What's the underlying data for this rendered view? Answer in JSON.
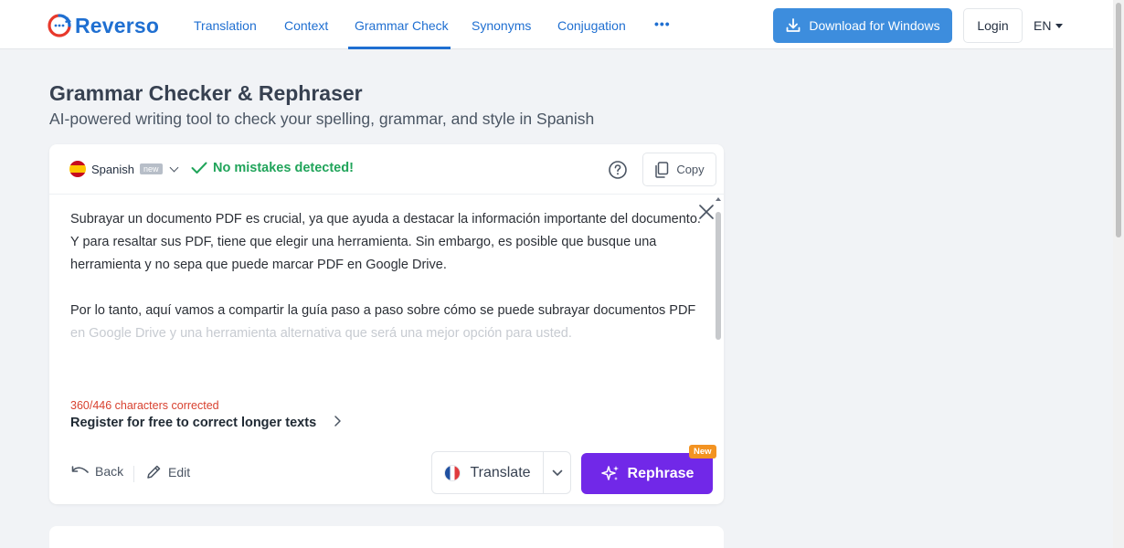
{
  "header": {
    "logo_text": "Reverso",
    "nav": [
      "Translation",
      "Context",
      "Grammar Check",
      "Synonyms",
      "Conjugation"
    ],
    "more_label": "•••",
    "download_label": "Download for Windows",
    "login_label": "Login",
    "lang_label": "EN"
  },
  "page": {
    "title": "Grammar Checker & Rephraser",
    "subtitle": "AI-powered writing tool to check your spelling, grammar, and style in Spanish"
  },
  "editor": {
    "language": "Spanish",
    "language_badge": "new",
    "status": "No mistakes detected!",
    "copy_label": "Copy",
    "paragraph1": "Subrayar un documento PDF es crucial, ya que ayuda a destacar la información importante del documento. Y para resaltar sus PDF, tiene que elegir una herramienta. Sin embargo, es posible que busque una herramienta y no sepa que puede marcar PDF en Google Drive.",
    "paragraph2_main": "Por lo tanto, aquí vamos a compartir la guía paso a paso sobre cómo se puede subrayar documentos PDF",
    "paragraph2_faded": " en Google Drive y una herramienta alternativa que será una mejor opción para usted.",
    "chars_corrected": "360/446 characters corrected",
    "register_text": "Register for free to correct longer texts",
    "back_label": "Back",
    "edit_label": "Edit",
    "translate_label": "Translate",
    "rephrase_label": "Rephrase",
    "rephrase_badge": "New"
  },
  "colors": {
    "brand_blue": "#1f6fd1",
    "success_green": "#20a45a",
    "error_red": "#d8412f",
    "rephrase_purple": "#7128e8",
    "badge_orange": "#f39322"
  }
}
